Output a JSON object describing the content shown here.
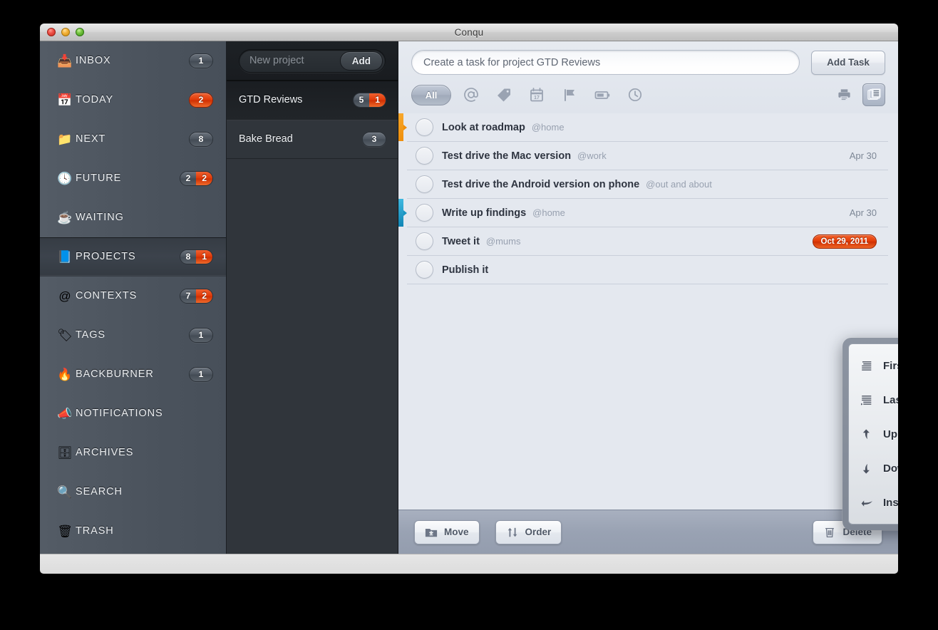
{
  "window": {
    "title": "Conqu",
    "traffic_lights": [
      "close",
      "minimize",
      "zoom"
    ]
  },
  "sidebar": {
    "items": [
      {
        "label": "INBOX",
        "icon": "inbox-tray-icon",
        "glyph": "📥",
        "badge": {
          "type": "grey",
          "value": "1"
        }
      },
      {
        "label": "TODAY",
        "icon": "calendar-icon",
        "glyph": "📅",
        "badge": {
          "type": "red",
          "value": "2"
        }
      },
      {
        "label": "NEXT",
        "icon": "folder-bookmark-icon",
        "glyph": "📁",
        "badge": {
          "type": "grey",
          "value": "8"
        }
      },
      {
        "label": "FUTURE",
        "icon": "clock-icon",
        "glyph": "🕓",
        "badge": {
          "type": "split",
          "left": "2",
          "right": "2"
        }
      },
      {
        "label": "WAITING",
        "icon": "coffee-cup-icon",
        "glyph": "☕",
        "badge": null
      },
      {
        "label": "PROJECTS",
        "icon": "project-book-icon",
        "glyph": "📘",
        "badge": {
          "type": "split",
          "left": "8",
          "right": "1"
        },
        "selected": true
      },
      {
        "label": "CONTEXTS",
        "icon": "at-sign-icon",
        "glyph": "@",
        "badge": {
          "type": "split",
          "left": "7",
          "right": "2"
        }
      },
      {
        "label": "TAGS",
        "icon": "tags-icon",
        "glyph": "🏷",
        "badge": {
          "type": "grey",
          "value": "1"
        }
      },
      {
        "label": "BACKBURNER",
        "icon": "flame-icon",
        "glyph": "🔥",
        "badge": {
          "type": "grey",
          "value": "1"
        }
      },
      {
        "label": "NOTIFICATIONS",
        "icon": "megaphone-icon",
        "glyph": "📣",
        "badge": null
      },
      {
        "label": "ARCHIVES",
        "icon": "archive-box-icon",
        "glyph": "🗄",
        "badge": null
      },
      {
        "label": "SEARCH",
        "icon": "magnifier-icon",
        "glyph": "🔍",
        "badge": null
      },
      {
        "label": "TRASH",
        "icon": "trash-can-icon",
        "glyph": "🗑",
        "badge": null
      }
    ]
  },
  "projects_panel": {
    "new_project_placeholder": "New project",
    "add_button_label": "Add",
    "items": [
      {
        "name": "GTD Reviews",
        "badge": {
          "type": "split",
          "left": "5",
          "right": "1"
        },
        "selected": true
      },
      {
        "name": "Bake Bread",
        "badge": {
          "type": "grey",
          "value": "3"
        }
      }
    ]
  },
  "main": {
    "create_task_placeholder": "Create a task for project GTD Reviews",
    "add_task_label": "Add Task",
    "filters": [
      {
        "label": "All",
        "icon": "all-filter-button",
        "active": true
      },
      {
        "label": "",
        "icon": "at-sign-icon"
      },
      {
        "label": "",
        "icon": "tag-icon"
      },
      {
        "label": "",
        "icon": "calendar-icon"
      },
      {
        "label": "",
        "icon": "flag-icon"
      },
      {
        "label": "",
        "icon": "battery-icon"
      },
      {
        "label": "",
        "icon": "clock-icon"
      }
    ],
    "view_buttons": [
      {
        "icon": "printer-icon",
        "active": false
      },
      {
        "icon": "list-view-icon",
        "active": true
      }
    ],
    "tasks": [
      {
        "title": "Look at roadmap",
        "context": "@home",
        "date": "",
        "overdue": false,
        "flag": "orange"
      },
      {
        "title": "Test drive the Mac version",
        "context": "@work",
        "date": "Apr 30",
        "overdue": false,
        "flag": ""
      },
      {
        "title": "Test drive the Android version on phone",
        "context": "@out and about",
        "date": "",
        "overdue": false,
        "flag": ""
      },
      {
        "title": "Write up findings",
        "context": "@home",
        "date": "Apr 30",
        "overdue": false,
        "flag": "blue"
      },
      {
        "title": "Tweet it",
        "context": "@mums",
        "date": "Oct 29, 2011",
        "overdue": true,
        "flag": ""
      },
      {
        "title": "Publish it",
        "context": "",
        "date": "",
        "overdue": false,
        "flag": ""
      }
    ]
  },
  "order_popover": {
    "items": [
      {
        "label": "First",
        "icon": "align-first-icon"
      },
      {
        "label": "Last",
        "icon": "align-last-icon"
      },
      {
        "label": "Up",
        "icon": "arrow-up-curved-icon"
      },
      {
        "label": "Down",
        "icon": "arrow-down-curved-icon"
      },
      {
        "label": "Insert after...",
        "icon": "arrow-return-icon"
      }
    ]
  },
  "bottom_toolbar": {
    "move_label": "Move",
    "order_label": "Order",
    "delete_label": "Delete"
  },
  "colors": {
    "accent_red": "#e03a08",
    "sidebar_bg": "#4b535d",
    "projects_bg": "#30353b",
    "main_bg": "#e4e8ef",
    "flag_orange": "#f09010",
    "flag_blue": "#1b95c2"
  }
}
